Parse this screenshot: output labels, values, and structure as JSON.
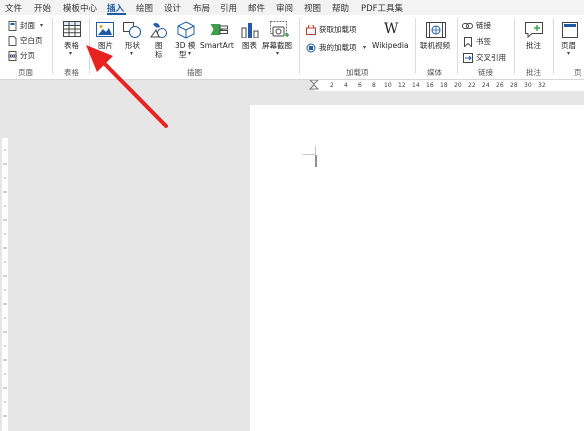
{
  "menu": {
    "tabs": [
      "文件",
      "开始",
      "模板中心",
      "插入",
      "绘图",
      "设计",
      "布局",
      "引用",
      "邮件",
      "审阅",
      "视图",
      "帮助",
      "PDF工具集"
    ],
    "active_tab": "插入"
  },
  "ribbon": {
    "pages_group": {
      "cover": "封面",
      "blank_page": "空白页",
      "page_break": "分页",
      "label": "页面"
    },
    "table_group": {
      "table": "表格",
      "label": "表格"
    },
    "illustrations_group": {
      "picture": "图片",
      "shapes": "形状",
      "icons_line1": "图",
      "icons_line2": "标",
      "model3d_line1": "3D 模",
      "model3d_line2": "型",
      "smartart": "SmartArt",
      "chart": "图表",
      "screenshot": "屏幕截图",
      "label": "插图"
    },
    "addins_group": {
      "get_addins": "获取加载项",
      "my_addins": "我的加载项",
      "wikipedia": "Wikipedia",
      "label": "加载项"
    },
    "media_group": {
      "online_video": "联机视频",
      "label": "媒体"
    },
    "links_group": {
      "link": "链接",
      "bookmark": "书签",
      "cross_reference": "交叉引用",
      "label": "链接"
    },
    "comments_group": {
      "comment": "批注",
      "label": "批注"
    },
    "header_group": {
      "header": "页眉",
      "label": "页"
    }
  },
  "ruler": {
    "numbers": [
      "2",
      "4",
      "6",
      "8",
      "10",
      "12",
      "14",
      "16",
      "18",
      "20",
      "22",
      "24",
      "26",
      "28",
      "30",
      "32"
    ]
  },
  "colors": {
    "accent": "#1f5ba6",
    "arrow": "#e8231f"
  }
}
